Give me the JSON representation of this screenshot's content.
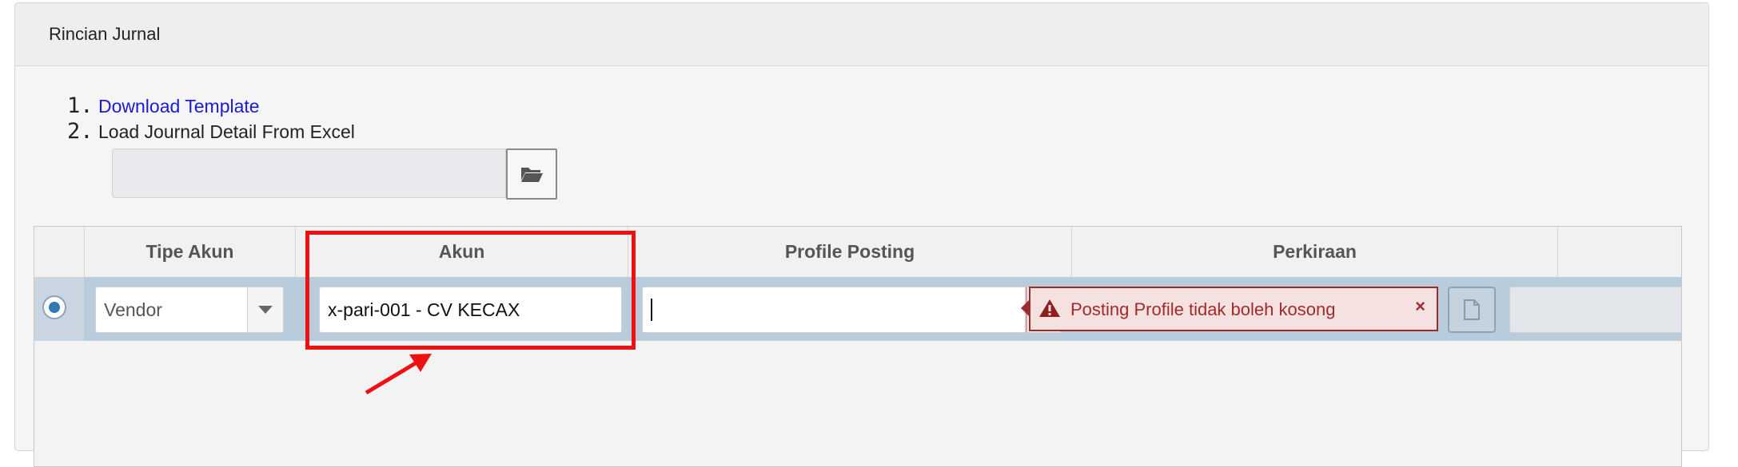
{
  "panel": {
    "title": "Rincian Jurnal"
  },
  "steps": [
    {
      "num": "1.",
      "label": "Download Template",
      "is_link": true
    },
    {
      "num": "2.",
      "label": "Load Journal Detail From Excel",
      "is_link": false
    }
  ],
  "file_upload": {
    "value": "",
    "button_icon": "folder-open-icon"
  },
  "grid": {
    "columns": [
      "",
      "Tipe Akun",
      "Akun",
      "Profile Posting",
      "Perkiraan",
      ""
    ],
    "row": {
      "selected": true,
      "tipe_akun": "Vendor",
      "akun": "x-pari-001 - CV KECAX",
      "profile_posting": "",
      "perkiraan": ""
    }
  },
  "validation": {
    "message": "Posting Profile tidak boleh kosong",
    "close_symbol": "×",
    "icon": "warning-icon",
    "color": "#a22a2a"
  },
  "annotation": {
    "highlight_color": "#ee1111"
  }
}
